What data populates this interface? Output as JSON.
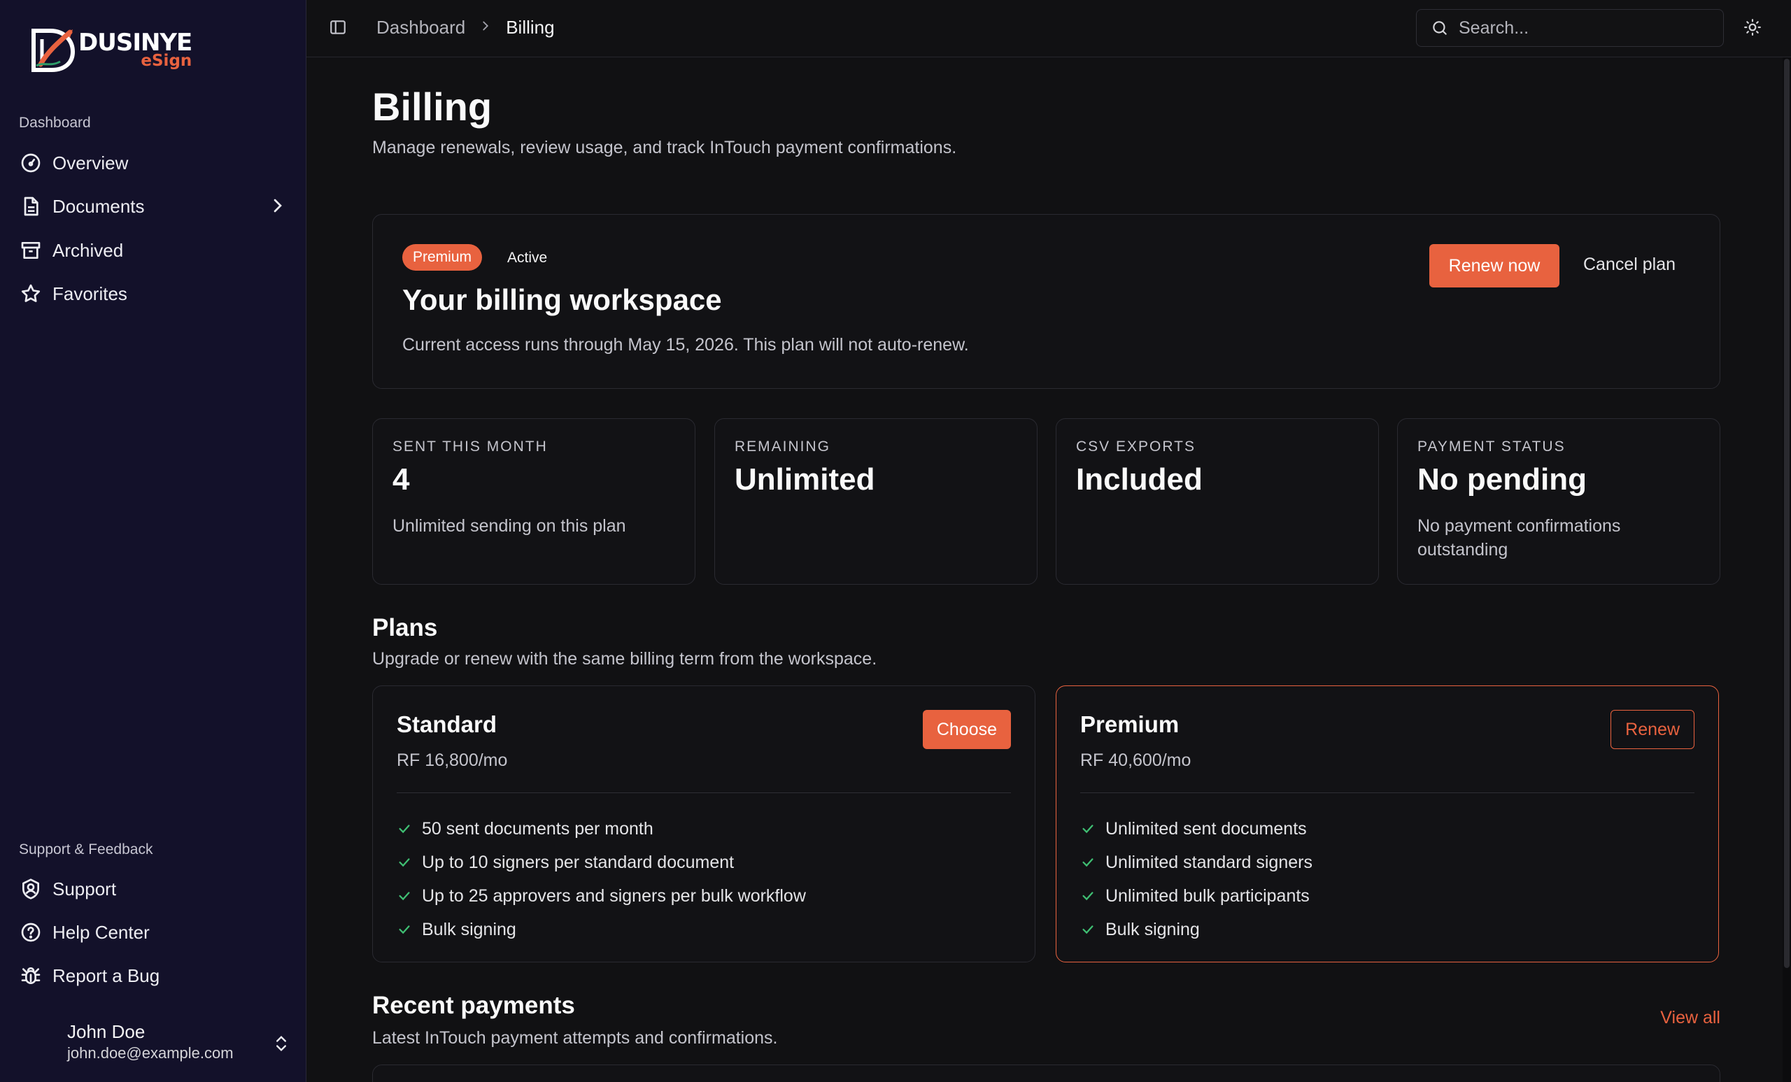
{
  "brand": {
    "name_line1": "DUSINYE",
    "name_line2": "eSign",
    "accent": "#e8623f"
  },
  "sidebar": {
    "group_main": "Dashboard",
    "items": [
      {
        "label": "Overview",
        "icon": "gauge-icon"
      },
      {
        "label": "Documents",
        "icon": "file-icon"
      },
      {
        "label": "Archived",
        "icon": "archive-icon"
      },
      {
        "label": "Favorites",
        "icon": "star-icon"
      }
    ],
    "group_support": "Support & Feedback",
    "support_items": [
      {
        "label": "Support",
        "icon": "user-shield-icon"
      },
      {
        "label": "Help Center",
        "icon": "help-circle-icon"
      },
      {
        "label": "Report a Bug",
        "icon": "bug-icon"
      }
    ],
    "user": {
      "name": "John Doe",
      "email": "john.doe@example.com"
    }
  },
  "topbar": {
    "breadcrumb": [
      "Dashboard",
      "Billing"
    ],
    "search_placeholder": "Search..."
  },
  "page": {
    "title": "Billing",
    "subtitle": "Manage renewals, review usage, and track InTouch payment confirmations."
  },
  "hero": {
    "plan_badge": "Premium",
    "status": "Active",
    "title": "Your billing workspace",
    "description": "Current access runs through May 15, 2026. This plan will not auto-renew.",
    "renew_label": "Renew now",
    "cancel_label": "Cancel plan"
  },
  "stats": [
    {
      "label": "SENT THIS MONTH",
      "value": "4",
      "desc": "Unlimited sending on this plan"
    },
    {
      "label": "REMAINING",
      "value": "Unlimited",
      "desc": ""
    },
    {
      "label": "CSV EXPORTS",
      "value": "Included",
      "desc": ""
    },
    {
      "label": "PAYMENT STATUS",
      "value": "No pending",
      "desc": "No payment confirmations outstanding"
    }
  ],
  "plans_section": {
    "title": "Plans",
    "subtitle": "Upgrade or renew with the same billing term from the workspace.",
    "plans": [
      {
        "name": "Standard",
        "price": "RF 16,800/mo",
        "action": "Choose",
        "features": [
          "50 sent documents per month",
          "Up to 10 signers per standard document",
          "Up to 25 approvers and signers per bulk workflow",
          "Bulk signing"
        ]
      },
      {
        "name": "Premium",
        "price": "RF 40,600/mo",
        "action": "Renew",
        "features": [
          "Unlimited sent documents",
          "Unlimited standard signers",
          "Unlimited bulk participants",
          "Bulk signing"
        ]
      }
    ]
  },
  "payments_section": {
    "title": "Recent payments",
    "subtitle": "Latest InTouch payment attempts and confirmations.",
    "view_all": "View all"
  }
}
